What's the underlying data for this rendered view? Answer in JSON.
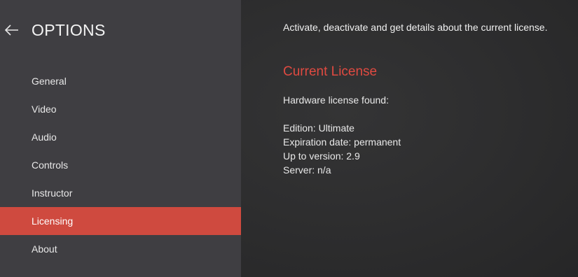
{
  "header": {
    "back_icon": "arrow-left-icon",
    "title": "OPTIONS"
  },
  "sidebar": {
    "items": [
      {
        "label": "General"
      },
      {
        "label": "Video"
      },
      {
        "label": "Audio"
      },
      {
        "label": "Controls"
      },
      {
        "label": "Instructor"
      },
      {
        "label": "Licensing",
        "active": true
      },
      {
        "label": "About"
      }
    ]
  },
  "main": {
    "description": "Activate, deactivate and get details about the current license.",
    "section_title": "Current License",
    "status": "Hardware license found:",
    "details": {
      "edition": "Edition: Ultimate",
      "expiration": "Expiration date: permanent",
      "version": "Up to version: 2.9",
      "server": "Server: n/a"
    }
  },
  "colors": {
    "accent": "#cf4a3f",
    "section_title": "#e04a41",
    "sidebar_bg": "#3f3e42",
    "main_bg": "#2e2e2f"
  }
}
